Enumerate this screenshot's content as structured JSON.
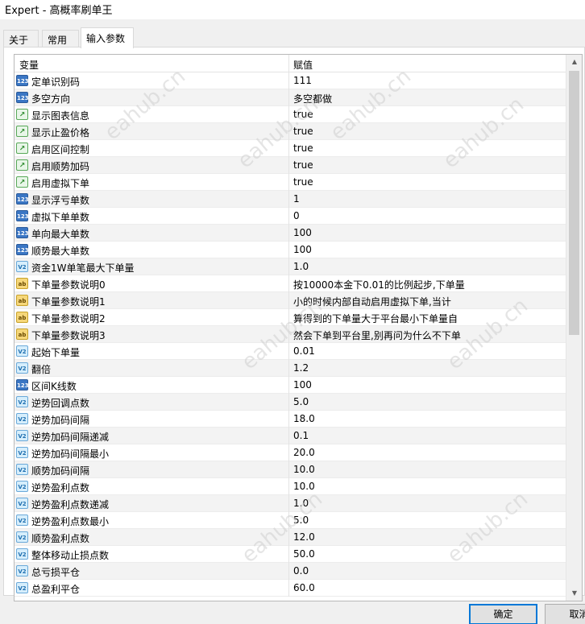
{
  "window": {
    "title": "Expert - 高概率刷单王"
  },
  "tabs": [
    {
      "label": "关于"
    },
    {
      "label": "常用"
    },
    {
      "label": "输入参数"
    }
  ],
  "grid": {
    "headers": {
      "variable": "变量",
      "value": "赋值"
    },
    "rows": [
      {
        "icon": "int",
        "name": "定单识别码",
        "value": "111"
      },
      {
        "icon": "int",
        "name": "多空方向",
        "value": "多空都做"
      },
      {
        "icon": "bool",
        "name": "显示图表信息",
        "value": "true"
      },
      {
        "icon": "bool",
        "name": "显示止盈价格",
        "value": "true"
      },
      {
        "icon": "bool",
        "name": "启用区间控制",
        "value": "true"
      },
      {
        "icon": "bool",
        "name": "启用顺势加码",
        "value": "true"
      },
      {
        "icon": "bool",
        "name": "启用虚拟下单",
        "value": "true"
      },
      {
        "icon": "int",
        "name": "显示浮亏单数",
        "value": "1"
      },
      {
        "icon": "int",
        "name": "虚拟下单单数",
        "value": "0"
      },
      {
        "icon": "int",
        "name": "单向最大单数",
        "value": "100"
      },
      {
        "icon": "int",
        "name": "顺势最大单数",
        "value": "100"
      },
      {
        "icon": "dbl",
        "name": "资金1W单笔最大下单量",
        "value": "1.0"
      },
      {
        "icon": "str",
        "name": "下单量参数说明0",
        "value": "按10000本金下0.01的比例起步,下单量"
      },
      {
        "icon": "str",
        "name": "下单量参数说明1",
        "value": "小的时候内部自动启用虚拟下单,当计"
      },
      {
        "icon": "str",
        "name": "下单量参数说明2",
        "value": "算得到的下单量大于平台最小下单量自"
      },
      {
        "icon": "str",
        "name": "下单量参数说明3",
        "value": "然会下单到平台里,别再问为什么不下单"
      },
      {
        "icon": "dbl",
        "name": "起始下单量",
        "value": "0.01"
      },
      {
        "icon": "dbl",
        "name": "翻倍",
        "value": "1.2"
      },
      {
        "icon": "int",
        "name": "区间K线数",
        "value": "100"
      },
      {
        "icon": "dbl",
        "name": "逆势回调点数",
        "value": "5.0"
      },
      {
        "icon": "dbl",
        "name": "逆势加码间隔",
        "value": "18.0"
      },
      {
        "icon": "dbl",
        "name": "逆势加码间隔递减",
        "value": "0.1"
      },
      {
        "icon": "dbl",
        "name": "逆势加码间隔最小",
        "value": "20.0"
      },
      {
        "icon": "dbl",
        "name": "顺势加码间隔",
        "value": "10.0"
      },
      {
        "icon": "dbl",
        "name": "逆势盈利点数",
        "value": "10.0"
      },
      {
        "icon": "dbl",
        "name": "逆势盈利点数递减",
        "value": "1.0"
      },
      {
        "icon": "dbl",
        "name": "逆势盈利点数最小",
        "value": "5.0"
      },
      {
        "icon": "dbl",
        "name": "顺势盈利点数",
        "value": "12.0"
      },
      {
        "icon": "dbl",
        "name": "整体移动止损点数",
        "value": "50.0"
      },
      {
        "icon": "dbl",
        "name": "总亏损平仓",
        "value": "0.0"
      },
      {
        "icon": "dbl",
        "name": "总盈利平仓",
        "value": "60.0"
      }
    ]
  },
  "icons": {
    "int": "123",
    "bool": "↗",
    "dbl": "V2",
    "str": "ab"
  },
  "scrollbar": {
    "up": "▲",
    "down": "▼"
  },
  "buttons": {
    "ok": "确定",
    "cancel": "取消"
  },
  "watermark": "eahub.cn"
}
